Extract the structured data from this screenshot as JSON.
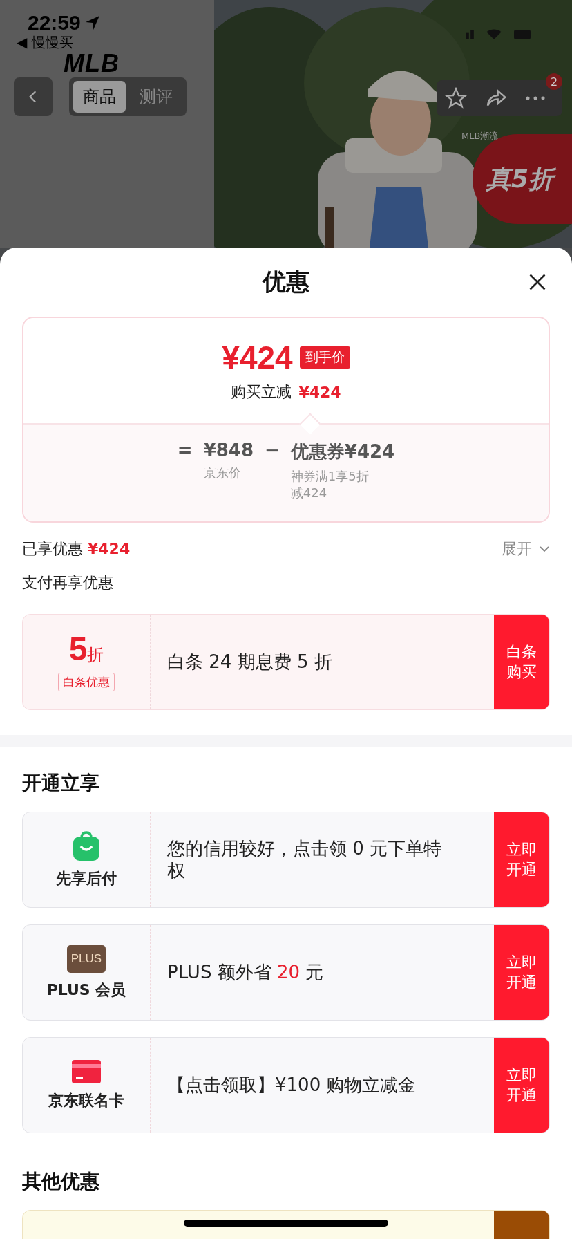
{
  "status_bar": {
    "time": "22:59",
    "back_app": "◀ 慢慢买"
  },
  "product": {
    "brand_logo": "MLB",
    "tabs": [
      {
        "label": "商品",
        "selected": true
      },
      {
        "label": "测评",
        "selected": false
      }
    ],
    "more_badge": "2",
    "caption": "MLB潮流",
    "promo_badge": "真5折"
  },
  "sheet": {
    "title": "优惠",
    "price_card": {
      "final_price": "¥424",
      "final_tag": "到手价",
      "instant_label": "购买立减",
      "instant_amount": "¥424",
      "equals": "=",
      "base_price": "¥848",
      "base_label": "京东价",
      "minus": "−",
      "coupon_label": "优惠券¥424",
      "coupon_note": "神券满1享5折减424"
    },
    "enjoyed": {
      "label": "已享优惠",
      "amount": "¥424",
      "expand": "展开"
    },
    "pay_section": {
      "title": "支付再享优惠",
      "offers": [
        {
          "discount": "5",
          "unit": "折",
          "tag": "白条优惠",
          "text": "白条 24 期息费 5 折",
          "action": "白条购买"
        }
      ]
    },
    "open_section": {
      "title": "开通立享",
      "offers": [
        {
          "kind": "bag",
          "name": "先享后付",
          "parts": [
            {
              "text": "您的信用较好，点击领 0 元下单特权",
              "highlight": false
            }
          ],
          "action": "立即开通"
        },
        {
          "kind": "plus",
          "icon_text": "PLUS",
          "name": "PLUS 会员",
          "parts": [
            {
              "text": "PLUS 额外省 ",
              "highlight": false
            },
            {
              "text": "20",
              "highlight": true
            },
            {
              "text": " 元",
              "highlight": false
            }
          ],
          "action": "立即开通"
        },
        {
          "kind": "card",
          "name": "京东联名卡",
          "parts": [
            {
              "text": "【点击领取】¥100 购物立减金",
              "highlight": false
            }
          ],
          "action": "立即开通"
        }
      ]
    },
    "other_section": {
      "title": "其他优惠"
    }
  }
}
